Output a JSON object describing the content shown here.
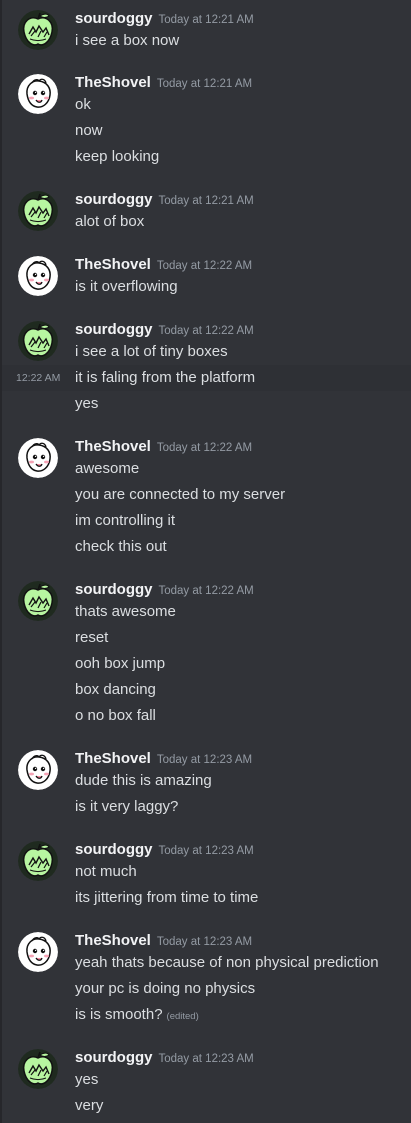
{
  "users": {
    "sourdoggy": {
      "name": "sourdoggy",
      "avatar": "green-apple-avatar"
    },
    "theshovel": {
      "name": "TheShovel",
      "avatar": "white-cartoon-face-avatar"
    }
  },
  "colors": {
    "background": "#313338",
    "username": "#f2f3f5",
    "message_text": "#dbdee1",
    "timestamp": "#949ba4",
    "hover_row": "#2e3035",
    "sourdoggy_avatar_bg": "#b7f5a0"
  },
  "messages": [
    {
      "author": "sourdoggy",
      "time": "Today at 12:21 AM",
      "lines": [
        "i see a box now"
      ]
    },
    {
      "author": "TheShovel",
      "time": "Today at 12:21 AM",
      "lines": [
        "ok",
        "now",
        "keep looking"
      ]
    },
    {
      "author": "sourdoggy",
      "time": "Today at 12:21 AM",
      "lines": [
        "alot of box"
      ]
    },
    {
      "author": "TheShovel",
      "time": "Today at 12:22 AM",
      "lines": [
        "is it overflowing"
      ]
    },
    {
      "author": "sourdoggy",
      "time": "Today at 12:22 AM",
      "lines": [
        "i see a lot of tiny boxes",
        "it is faling from the platform",
        "yes"
      ],
      "hover_time": "12:22 AM"
    },
    {
      "author": "TheShovel",
      "time": "Today at 12:22 AM",
      "lines": [
        "awesome",
        "you are connected to my server",
        "im controlling it",
        "check this out"
      ]
    },
    {
      "author": "sourdoggy",
      "time": "Today at 12:22 AM",
      "lines": [
        "thats awesome",
        "reset",
        "ooh box jump",
        "box dancing",
        "o no box fall"
      ]
    },
    {
      "author": "TheShovel",
      "time": "Today at 12:23 AM",
      "lines": [
        "dude this is amazing",
        "is it very laggy?"
      ]
    },
    {
      "author": "sourdoggy",
      "time": "Today at 12:23 AM",
      "lines": [
        "not much",
        "its jittering from time to time"
      ]
    },
    {
      "author": "TheShovel",
      "time": "Today at 12:23 AM",
      "lines": [
        "yeah thats because of non physical prediction",
        "your pc is doing no physics",
        "is is smooth?"
      ],
      "edited": "(edited)"
    },
    {
      "author": "sourdoggy",
      "time": "Today at 12:23 AM",
      "lines": [
        "yes",
        "very"
      ]
    }
  ]
}
